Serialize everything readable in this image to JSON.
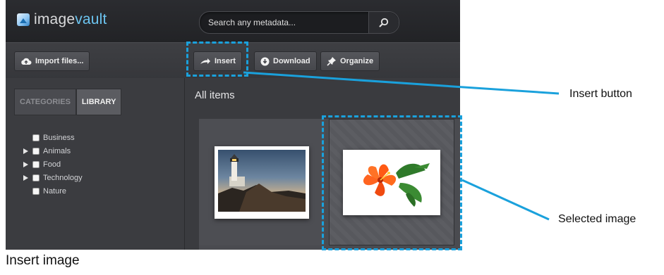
{
  "app": {
    "logo_text_primary": "image",
    "logo_text_accent": "vault",
    "search_placeholder": "Search any metadata..."
  },
  "toolbar": {
    "import_label": "Import files...",
    "insert_label": "Insert",
    "download_label": "Download",
    "organize_label": "Organize"
  },
  "sidebar": {
    "tabs": [
      {
        "label": "CATEGORIES",
        "active": false
      },
      {
        "label": "LIBRARY",
        "active": true
      }
    ],
    "categories": [
      {
        "label": "Business",
        "expandable": false
      },
      {
        "label": "Animals",
        "expandable": true
      },
      {
        "label": "Food",
        "expandable": true
      },
      {
        "label": "Technology",
        "expandable": true
      },
      {
        "label": "Nature",
        "expandable": false
      }
    ]
  },
  "main": {
    "title": "All items",
    "items": [
      {
        "name": "lighthouse-image",
        "selected": false
      },
      {
        "name": "hibiscus-flower-image",
        "selected": true
      }
    ]
  },
  "annotations": {
    "insert_note": "Insert button",
    "selected_note": "Selected image",
    "caption": "Insert image",
    "accent_color": "#1aa1dc"
  }
}
